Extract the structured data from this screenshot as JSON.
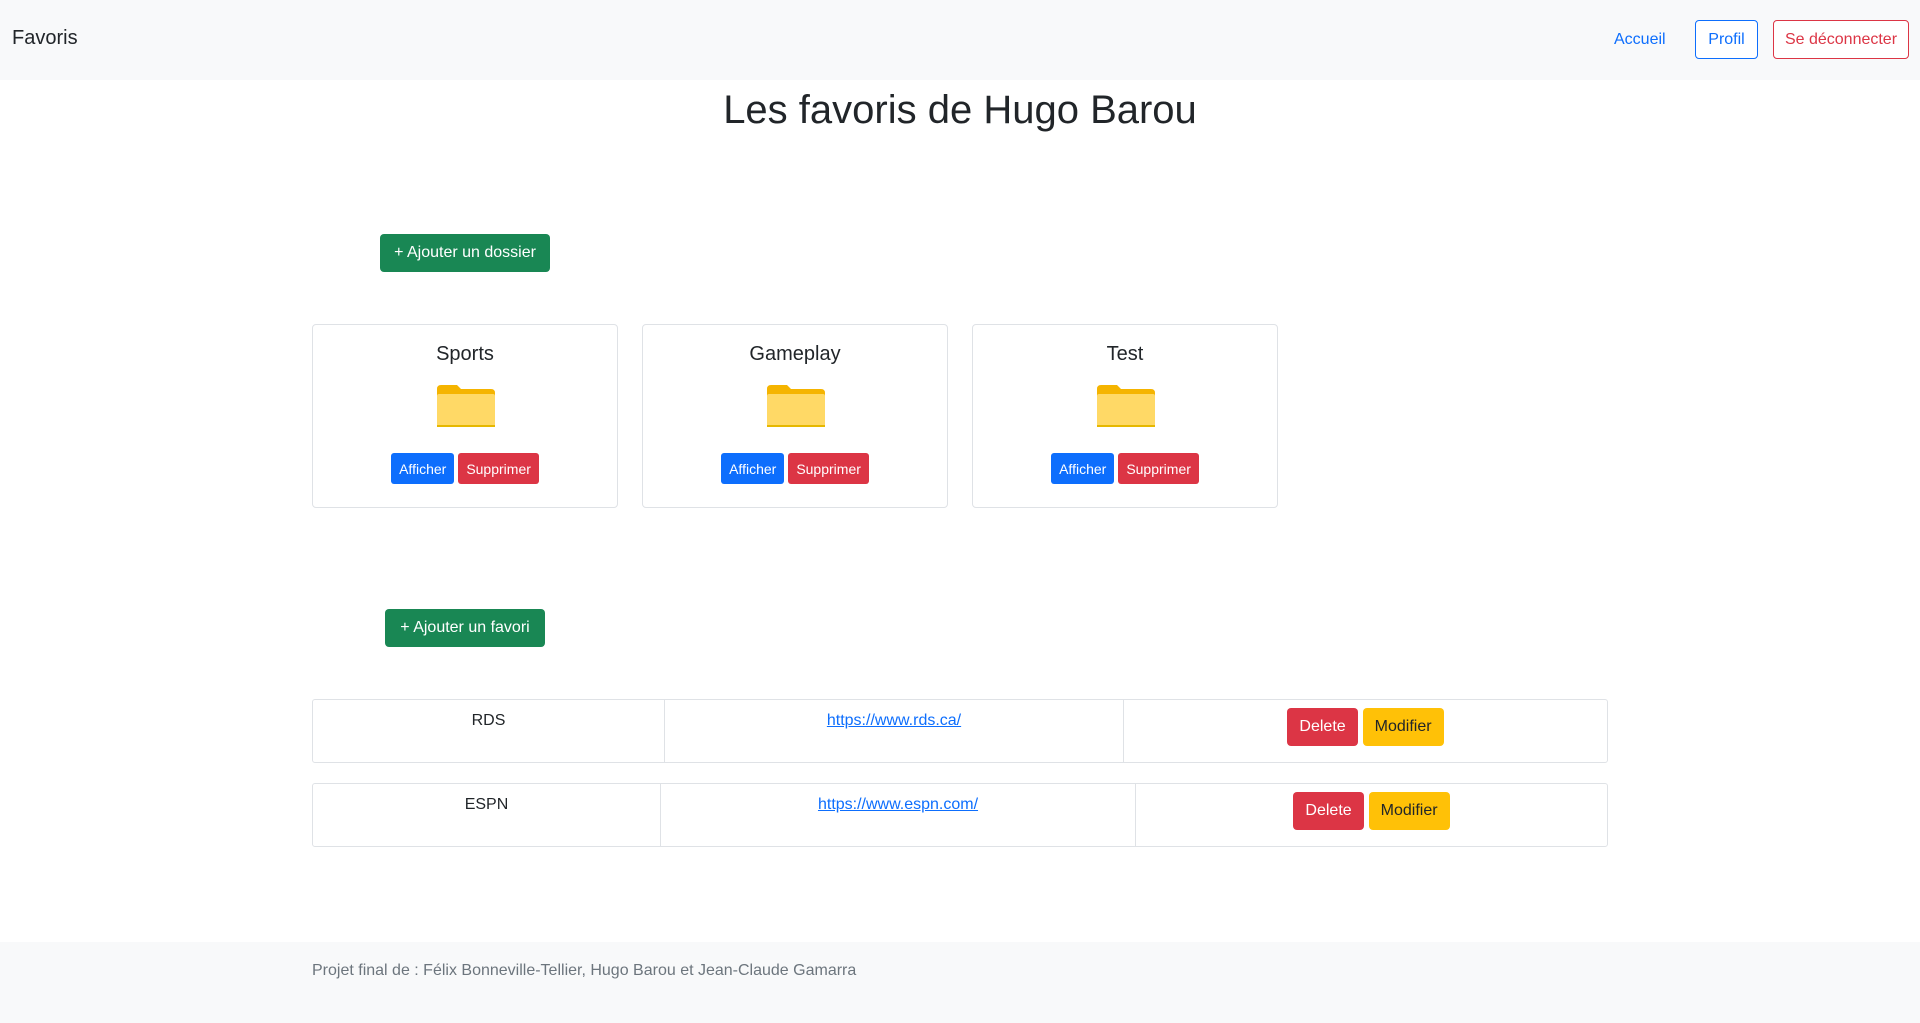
{
  "navbar": {
    "brand": "Favoris",
    "home_link": "Accueil",
    "profile_button": "Profil",
    "logout_button": "Se déconnecter"
  },
  "page": {
    "title": "Les favoris de Hugo Barou"
  },
  "folders": {
    "add_button": "+ Ajouter un dossier",
    "items": [
      {
        "name": "Sports",
        "show_label": "Afficher",
        "delete_label": "Supprimer",
        "icon": "folder-icon"
      },
      {
        "name": "Gameplay",
        "show_label": "Afficher",
        "delete_label": "Supprimer",
        "icon": "folder-icon"
      },
      {
        "name": "Test",
        "show_label": "Afficher",
        "delete_label": "Supprimer",
        "icon": "folder-icon"
      }
    ]
  },
  "favorites": {
    "add_button": "+ Ajouter un favori",
    "items": [
      {
        "name": "RDS",
        "url": "https://www.rds.ca/",
        "delete_label": "Delete",
        "edit_label": "Modifier"
      },
      {
        "name": "ESPN",
        "url": "https://www.espn.com/",
        "delete_label": "Delete",
        "edit_label": "Modifier"
      }
    ]
  },
  "footer": {
    "text": "Projet final de : Félix Bonneville-Tellier, Hugo Barou et Jean-Claude Gamarra"
  },
  "colors": {
    "primary": "#0d6efd",
    "danger": "#dc3545",
    "success": "#198754",
    "warning": "#ffc107",
    "folder": "#ffd966"
  }
}
